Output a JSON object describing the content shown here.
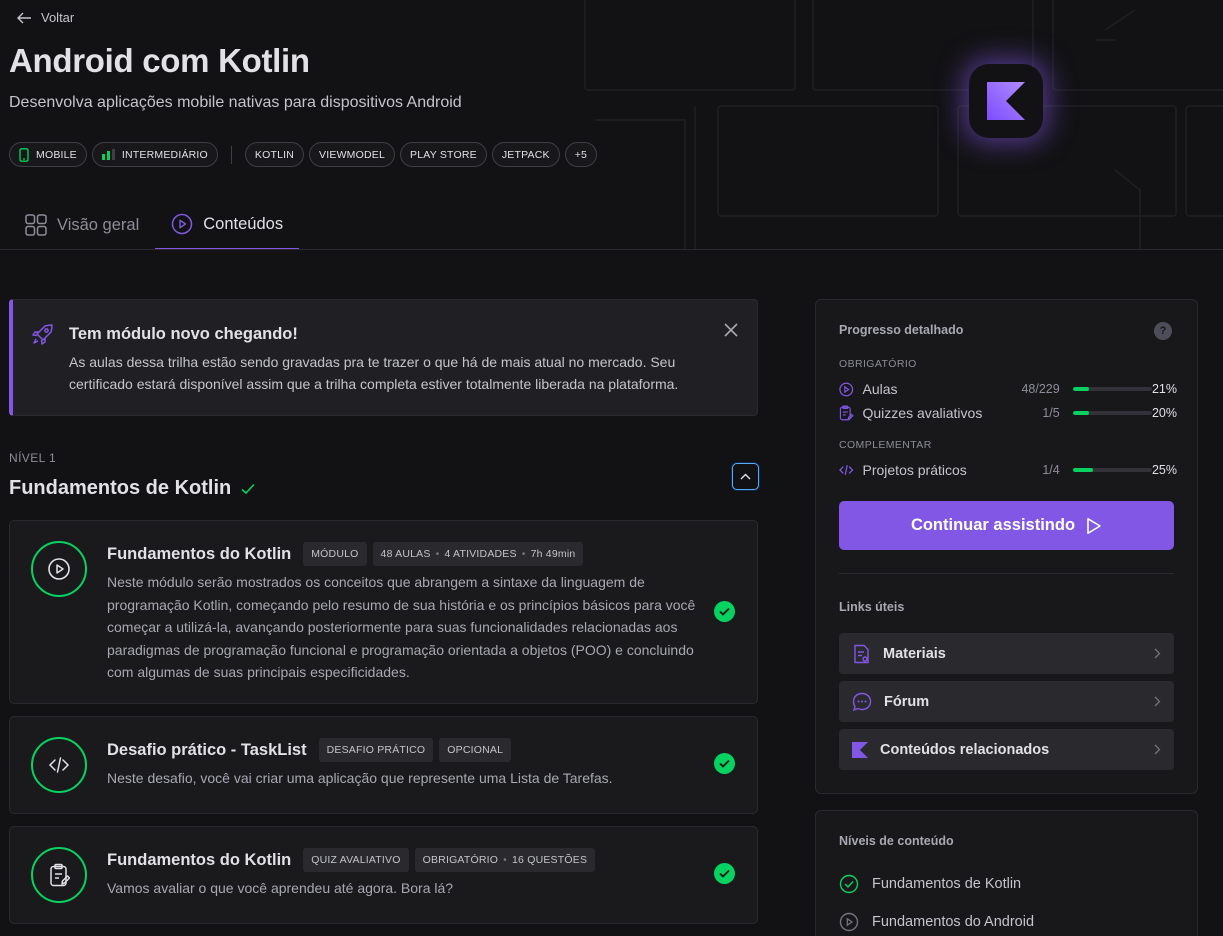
{
  "header": {
    "back_label": "Voltar",
    "title": "Android com Kotlin",
    "subtitle": "Desenvolva aplicações mobile nativas para dispositivos Android",
    "tags": [
      "MOBILE",
      "INTERMEDIÁRIO",
      "KOTLIN",
      "VIEWMODEL",
      "PLAY STORE",
      "JETPACK",
      "+5"
    ]
  },
  "tabs": [
    {
      "label": "Visão geral",
      "icon": "grid-icon",
      "active": false
    },
    {
      "label": "Conteúdos",
      "icon": "play-circle-icon",
      "active": true
    }
  ],
  "notice": {
    "title": "Tem módulo novo chegando!",
    "text": "As aulas dessa trilha estão sendo gravadas pra te trazer o que há de mais atual no mercado. Seu certificado estará disponível assim que a trilha completa estiver totalmente liberada na plataforma."
  },
  "level": {
    "label": "NÍVEL 1",
    "title": "Fundamentos de Kotlin"
  },
  "cards": [
    {
      "title": "Fundamentos do Kotlin",
      "badges": [
        "MÓDULO"
      ],
      "meta": [
        "48 AULAS",
        "4 ATIVIDADES",
        "7h 49min"
      ],
      "description": "Neste módulo serão mostrados os conceitos que abrangem a sintaxe da linguagem de programação Kotlin, começando pelo resumo de sua história e os princípios básicos para você começar a utilizá-la, avançando posteriormente para suas funcionalidades relacionadas aos paradigmas de programação funcional e programação orientada a objetos (POO) e concluindo com algumas de suas principais especificidades.",
      "icon": "play-circle-icon",
      "completed": true
    },
    {
      "title": "Desafio prático - TaskList",
      "badges": [
        "DESAFIO PRÁTICO",
        "OPCIONAL"
      ],
      "description": "Neste desafio, você vai criar uma aplicação que represente uma Lista de Tarefas.",
      "icon": "code-icon",
      "completed": true
    },
    {
      "title": "Fundamentos do Kotlin",
      "badges": [
        "QUIZ AVALIATIVO"
      ],
      "meta": [
        "OBRIGATÓRIO",
        "16 QUESTÕES"
      ],
      "description": "Vamos avaliar o que você aprendeu até agora. Bora lá?",
      "icon": "clipboard-icon",
      "completed": true
    }
  ],
  "progress": {
    "title": "Progresso detalhado",
    "help": "?",
    "required_label": "OBRIGATÓRIO",
    "complementary_label": "COMPLEMENTAR",
    "rows": [
      {
        "name": "Aulas",
        "count": "48/229",
        "percent": "21%",
        "fraction": 0.21
      },
      {
        "name": "Quizzes avaliativos",
        "count": "1/5",
        "percent": "20%",
        "fraction": 0.2
      },
      {
        "name": "Projetos práticos",
        "count": "1/4",
        "percent": "25%",
        "fraction": 0.25
      }
    ],
    "cta_label": "Continuar assistindo"
  },
  "links": {
    "title": "Links úteis",
    "items": [
      "Materiais",
      "Fórum",
      "Conteúdos relacionados"
    ]
  },
  "levels": {
    "title": "Níveis de conteúdo",
    "items": [
      "Fundamentos de Kotlin",
      "Fundamentos do Android"
    ]
  },
  "colors": {
    "accent": "#8257e5",
    "success": "#04d361",
    "background": "#121214"
  }
}
